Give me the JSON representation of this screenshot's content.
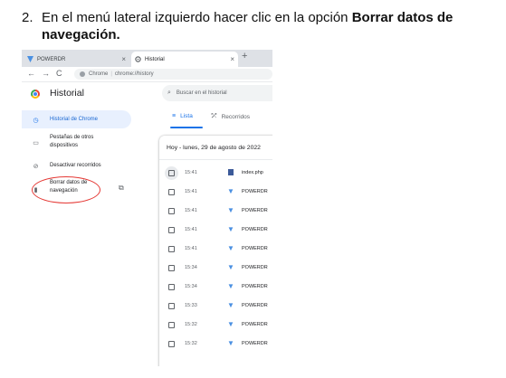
{
  "instruction": {
    "number": "2.",
    "text": "En el menú lateral izquierdo hacer clic en la opción ",
    "bold_1": "Borrar datos de",
    "bold_2": "navegación."
  },
  "browser": {
    "tabs": [
      {
        "title": "POWERDR",
        "close": "×"
      },
      {
        "title": "Historial",
        "close": "×"
      }
    ],
    "new_tab": "+",
    "nav": {
      "back": "←",
      "forward": "→",
      "reload": "C"
    },
    "omnibox": {
      "site": "Chrome",
      "separator": "|",
      "url": "chrome://history"
    }
  },
  "history_page": {
    "title": "Historial",
    "search_placeholder": "Buscar en el historial",
    "sidebar": [
      {
        "label": "Historial de Chrome",
        "icon": "clock-icon",
        "glyph": "◷"
      },
      {
        "label": "Pestañas de otros dispositivos",
        "icon": "devices-icon",
        "glyph": "▭"
      },
      {
        "label": "Desactivar recorridos",
        "icon": "journeys-off-icon",
        "glyph": "⊘"
      },
      {
        "label": "Borrar datos de navegación",
        "icon": "trash-icon",
        "glyph": "▮"
      }
    ],
    "external_link_glyph": "⧉",
    "tabs": [
      {
        "label": "Lista",
        "icon": "list-icon",
        "glyph": "≡"
      },
      {
        "label": "Recorridos",
        "icon": "journeys-icon",
        "glyph": "⤱"
      }
    ],
    "day_header": "Hoy - lunes, 29 de agosto de 2022",
    "entries": [
      {
        "time": "15:41",
        "site": "index.php",
        "favicon": "doc"
      },
      {
        "time": "15:41",
        "site": "POWERDR",
        "favicon": "tri"
      },
      {
        "time": "15:41",
        "site": "POWERDR",
        "favicon": "tri"
      },
      {
        "time": "15:41",
        "site": "POWERDR",
        "favicon": "tri"
      },
      {
        "time": "15:41",
        "site": "POWERDR",
        "favicon": "tri"
      },
      {
        "time": "15:34",
        "site": "POWERDR",
        "favicon": "tri"
      },
      {
        "time": "15:34",
        "site": "POWERDR",
        "favicon": "tri"
      },
      {
        "time": "15:33",
        "site": "POWERDR",
        "favicon": "tri"
      },
      {
        "time": "15:32",
        "site": "POWERDR",
        "favicon": "tri"
      },
      {
        "time": "15:32",
        "site": "POWERDR",
        "favicon": "tri"
      }
    ]
  },
  "colors": {
    "accent": "#1a73e8",
    "highlight_circle": "#e53935",
    "active_bg": "#e8f0fe"
  }
}
